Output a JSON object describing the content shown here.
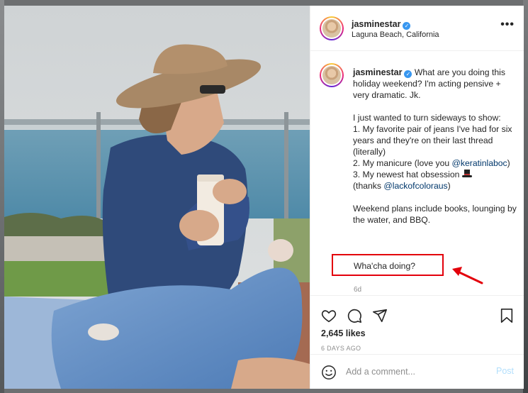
{
  "header": {
    "username": "jasminestar",
    "location": "Laguna Beach, California",
    "more_label": "•••"
  },
  "caption": {
    "username": "jasminestar",
    "line_intro": "What are you doing this holiday weekend? I'm acting pensive + very dramatic. Jk.",
    "line_sideways": "I just wanted to turn sideways to show:",
    "item1": "1. My favorite pair of jeans I've had for six years and they're on their last thread (literally)",
    "item2_prefix": "2. My manicure (love you",
    "item2_mention": "@keratinlaboc",
    "item2_suffix": ")",
    "item3": "3. My newest hat obsession",
    "item3_thanks_prefix": "(thanks",
    "item3_mention": "@lackofcoloraus",
    "item3_suffix": ")",
    "weekend": "Weekend plans include books, lounging by the water, and BBQ.",
    "question": "Wha'cha doing?",
    "age": "6d"
  },
  "actions": {
    "likes": "2,645 likes",
    "date": "6 DAYS AGO"
  },
  "add_comment": {
    "placeholder": "Add a comment...",
    "post_label": "Post"
  },
  "colors": {
    "highlight_box": "#e3000b",
    "mention": "#00376b",
    "post_disabled": "#b2dffc",
    "verified": "#3897f0"
  },
  "icons": [
    "heart-icon",
    "comment-icon",
    "share-icon",
    "bookmark-icon",
    "smiley-icon",
    "verified-icon",
    "more-options-icon",
    "top-hat-emoji",
    "red-arrow"
  ]
}
